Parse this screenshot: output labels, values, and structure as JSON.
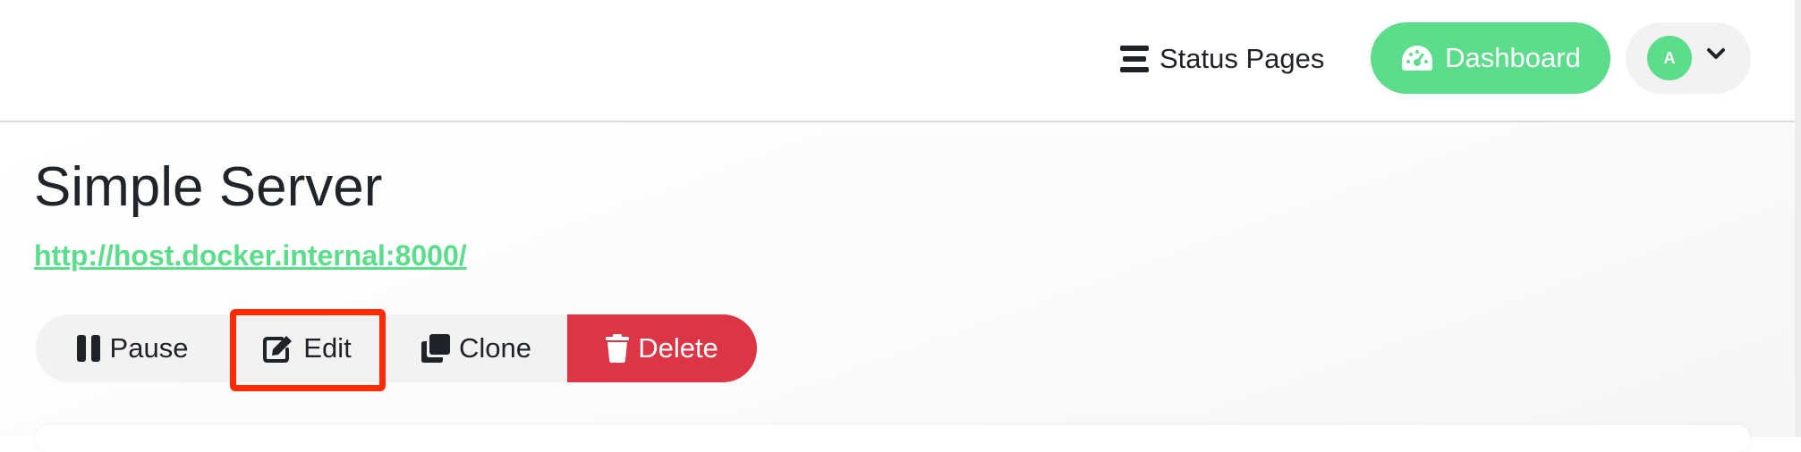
{
  "header": {
    "status_pages_label": "Status Pages",
    "status_pages_icon": "list-icon",
    "dashboard_label": "Dashboard",
    "dashboard_icon": "tachometer-icon",
    "profile": {
      "avatar_initial": "A",
      "dropdown_icon": "chevron-down-icon"
    }
  },
  "monitor": {
    "title": "Simple Server",
    "url": "http://host.docker.internal:8000/"
  },
  "actions": {
    "pause_label": "Pause",
    "pause_icon": "pause-icon",
    "edit_label": "Edit",
    "edit_icon": "edit-icon",
    "clone_label": "Clone",
    "clone_icon": "clone-icon",
    "delete_label": "Delete",
    "delete_icon": "trash-icon"
  },
  "colors": {
    "accent_green": "#5cdd8b",
    "danger_red": "#dc3545",
    "highlight_red": "#ff2a00"
  }
}
